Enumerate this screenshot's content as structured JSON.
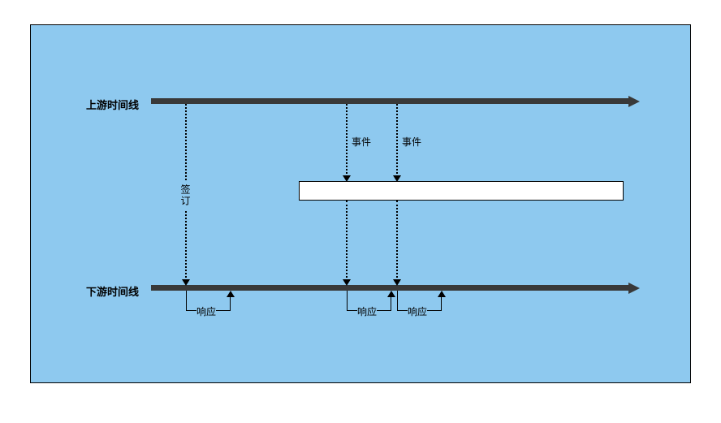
{
  "timelines": {
    "upstream_label": "上游时间线",
    "downstream_label": "下游时间线"
  },
  "annotations": {
    "subscribe": "签订",
    "event1": "事件",
    "event2": "事件",
    "response1": "响应",
    "response2": "响应",
    "response3": "响应"
  }
}
